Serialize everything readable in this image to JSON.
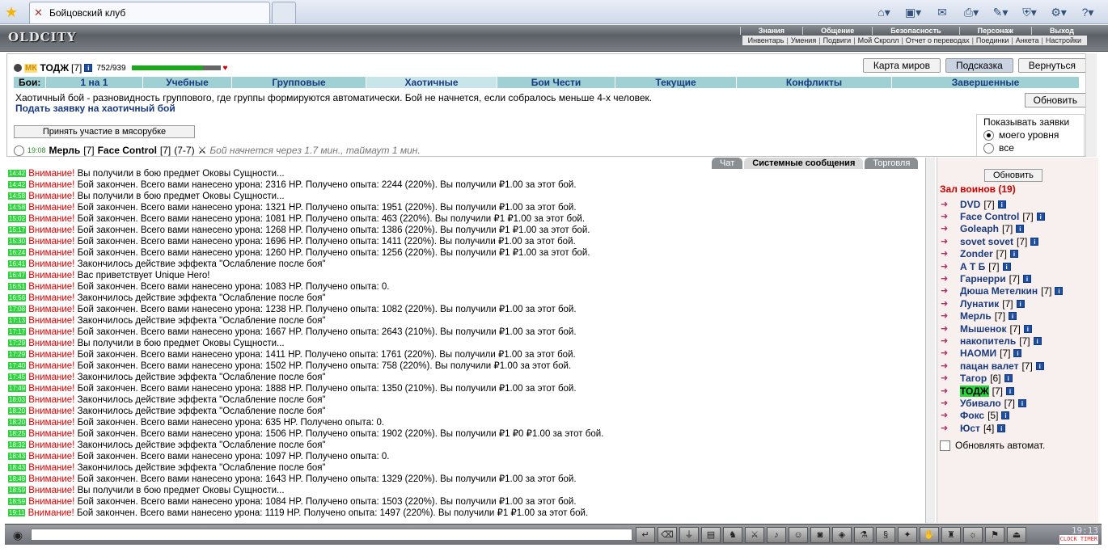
{
  "browser": {
    "tab_title": "Бойцовский клуб",
    "tools": [
      "home-icon",
      "feeds-icon",
      "read-mail-icon",
      "print-icon",
      "page-icon",
      "safety-icon",
      "tools-icon",
      "help-icon"
    ]
  },
  "header": {
    "logo": "OLDCITY",
    "top_nav": [
      "Знания",
      "Общение",
      "Безопасность",
      "Персонаж",
      "Выход"
    ],
    "sub_nav": [
      "Инвентарь",
      "Умения",
      "Подвиги",
      "Мой Скролл",
      "Отчет о переводах",
      "Поединки",
      "Анкета",
      "Настройки"
    ]
  },
  "character": {
    "clan": "МК",
    "name": "ТОДЖ",
    "level": "[7]",
    "hp": "752/939",
    "hp_fraction": 0.8
  },
  "top_buttons": [
    "Карта миров",
    "Подсказка",
    "Вернуться"
  ],
  "fight_tabs": {
    "label": "Бои:",
    "items": [
      "1 на 1",
      "Учебные",
      "Групповые",
      "Хаотичные",
      "Бои Чести",
      "Текущие",
      "Конфликты",
      "Завершенные"
    ],
    "active_index": 3
  },
  "chaos": {
    "description": "Хаотичный бой - разновидность группового, где группы формируются автоматически. Бой не начнется, если собралось меньше 4-х человек.",
    "apply_link": "Подать заявку на хаотичный бой",
    "refresh": "Обновить",
    "join_button": "Принять участие в мясорубке",
    "show_title": "Показывать заявки",
    "show_options": [
      "моего уровня",
      "все"
    ],
    "bid": {
      "time": "19:08",
      "team1": "Мерль",
      "team1_lvl": "[7]",
      "team2": "Face Control",
      "team2_lvl": "[7]",
      "range": "(7-7)",
      "note": "Бой начнется через 1.7 мин., таймаут 1 мин."
    }
  },
  "chat_tabs": [
    "Чат",
    "Системные сообщения",
    "Торговля"
  ],
  "log": [
    {
      "time": "14:42",
      "text": "Вы получили в бою предмет Оковы Сущности..."
    },
    {
      "time": "14:42",
      "text": "Бой закончен. Всего вами нанесено урона: 2316 HP. Получено опыта: 2244 (220%). Вы получили ₽1.00 за этот бой."
    },
    {
      "time": "14:58",
      "text": "Вы получили в бою предмет Оковы Сущности..."
    },
    {
      "time": "14:58",
      "text": "Бой закончен. Всего вами нанесено урона: 1321 HP. Получено опыта: 1951 (220%). Вы получили ₽1.00 за этот бой."
    },
    {
      "time": "15:02",
      "text": "Бой закончен. Всего вами нанесено урона: 1081 HP. Получено опыта: 463 (220%). Вы получили ₽1 ₽1.00 за этот бой."
    },
    {
      "time": "15:17",
      "text": "Бой закончен. Всего вами нанесено урона: 1268 HP. Получено опыта: 1386 (220%). Вы получили ₽1 ₽1.00 за этот бой."
    },
    {
      "time": "15:30",
      "text": "Бой закончен. Всего вами нанесено урона: 1696 HP. Получено опыта: 1411 (220%). Вы получили ₽1.00 за этот бой."
    },
    {
      "time": "16:24",
      "text": "Бой закончен. Всего вами нанесено урона: 1260 HP. Получено опыта: 1256 (220%). Вы получили ₽1 ₽1.00 за этот бой."
    },
    {
      "time": "16:41",
      "text": "Закончилось действие эффекта \"Ослабление после боя\""
    },
    {
      "time": "16:47",
      "text": "Вас приветствует Unique Hero!"
    },
    {
      "time": "16:51",
      "text": "Бой закончен. Всего вами нанесено урона: 1083 HP. Получено опыта: 0."
    },
    {
      "time": "16:56",
      "text": "Закончилось действие эффекта \"Ослабление после боя\""
    },
    {
      "time": "17:08",
      "text": "Бой закончен. Всего вами нанесено урона: 1238 HP. Получено опыта: 1082 (220%). Вы получили ₽1.00 за этот бой."
    },
    {
      "time": "17:13",
      "text": "Закончилось действие эффекта \"Ослабление после боя\""
    },
    {
      "time": "17:17",
      "text": "Бой закончен. Всего вами нанесено урона: 1667 HP. Получено опыта: 2643 (210%). Вы получили ₽1.00 за этот бой."
    },
    {
      "time": "17:29",
      "text": "Вы получили в бою предмет Оковы Сущности..."
    },
    {
      "time": "17:29",
      "text": "Бой закончен. Всего вами нанесено урона: 1411 HP. Получено опыта: 1761 (220%). Вы получили ₽1.00 за этот бой."
    },
    {
      "time": "17:40",
      "text": "Бой закончен. Всего вами нанесено урона: 1502 HP. Получено опыта: 758 (220%). Вы получили ₽1.00 за этот бой."
    },
    {
      "time": "17:45",
      "text": "Закончилось действие эффекта \"Ослабление после боя\""
    },
    {
      "time": "17:49",
      "text": "Бой закончен. Всего вами нанесено урона: 1888 HP. Получено опыта: 1350 (210%). Вы получили ₽1.00 за этот бой."
    },
    {
      "time": "18:03",
      "text": "Закончилось действие эффекта \"Ослабление после боя\""
    },
    {
      "time": "18:20",
      "text": "Закончилось действие эффекта \"Ослабление после боя\""
    },
    {
      "time": "18:20",
      "text": "Бой закончен. Всего вами нанесено урона: 635 HP. Получено опыта: 0."
    },
    {
      "time": "18:25",
      "text": "Бой закончен. Всего вами нанесено урона: 1506 HP. Получено опыта: 1902 (220%). Вы получили ₽1 ₽0 ₽1.00 за этот бой."
    },
    {
      "time": "18:32",
      "text": "Закончилось действие эффекта \"Ослабление после боя\""
    },
    {
      "time": "18:43",
      "text": "Бой закончен. Всего вами нанесено урона: 1097 HP. Получено опыта: 0."
    },
    {
      "time": "18:43",
      "text": "Закончилось действие эффекта \"Ослабление после боя\""
    },
    {
      "time": "18:49",
      "text": "Бой закончен. Всего вами нанесено урона: 1643 HP. Получено опыта: 1329 (220%). Вы получили ₽1.00 за этот бой."
    },
    {
      "time": "18:59",
      "text": "Вы получили в бою предмет Оковы Сущности..."
    },
    {
      "time": "18:59",
      "text": "Бой закончен. Всего вами нанесено урона: 1084 HP. Получено опыта: 1503 (220%). Вы получили ₽1.00 за этот бой."
    },
    {
      "time": "19:11",
      "text": "Бой закончен. Всего вами нанесено урона: 1119 HP. Получено опыта: 1497 (220%). Вы получили ₽1 ₽1.00 за этот бой."
    }
  ],
  "log_warning": "Внимание!",
  "users": {
    "refresh": "Обновить",
    "title": "Зал воинов (19)",
    "list": [
      {
        "name": "DVD",
        "lvl": "[7]"
      },
      {
        "name": "Face Control",
        "lvl": "[7]"
      },
      {
        "name": "Goleaph",
        "lvl": "[7]"
      },
      {
        "name": "sovet sovet",
        "lvl": "[7]"
      },
      {
        "name": "Zonder",
        "lvl": "[7]"
      },
      {
        "name": "А Т Б",
        "lvl": "[7]"
      },
      {
        "name": "Гарнерри",
        "lvl": "[7]"
      },
      {
        "name": "Дюша Метелкин",
        "lvl": "[7]"
      },
      {
        "name": "Лунатик",
        "lvl": "[7]"
      },
      {
        "name": "Мерль",
        "lvl": "[7]"
      },
      {
        "name": "Мышенок",
        "lvl": "[7]"
      },
      {
        "name": "накопитель",
        "lvl": "[7]"
      },
      {
        "name": "НАОМИ",
        "lvl": "[7]"
      },
      {
        "name": "пацан валет",
        "lvl": "[7]"
      },
      {
        "name": "Тагор",
        "lvl": "[6]"
      },
      {
        "name": "ТОДЖ",
        "lvl": "[7]",
        "self": true
      },
      {
        "name": "Убивало",
        "lvl": "[7]"
      },
      {
        "name": "Фокс",
        "lvl": "[5]"
      },
      {
        "name": "Юст",
        "lvl": "[4]"
      }
    ],
    "auto_refresh": "Обновлять автомат."
  },
  "clock": {
    "time": "19:13",
    "labels": "CLOCK TIMER"
  }
}
